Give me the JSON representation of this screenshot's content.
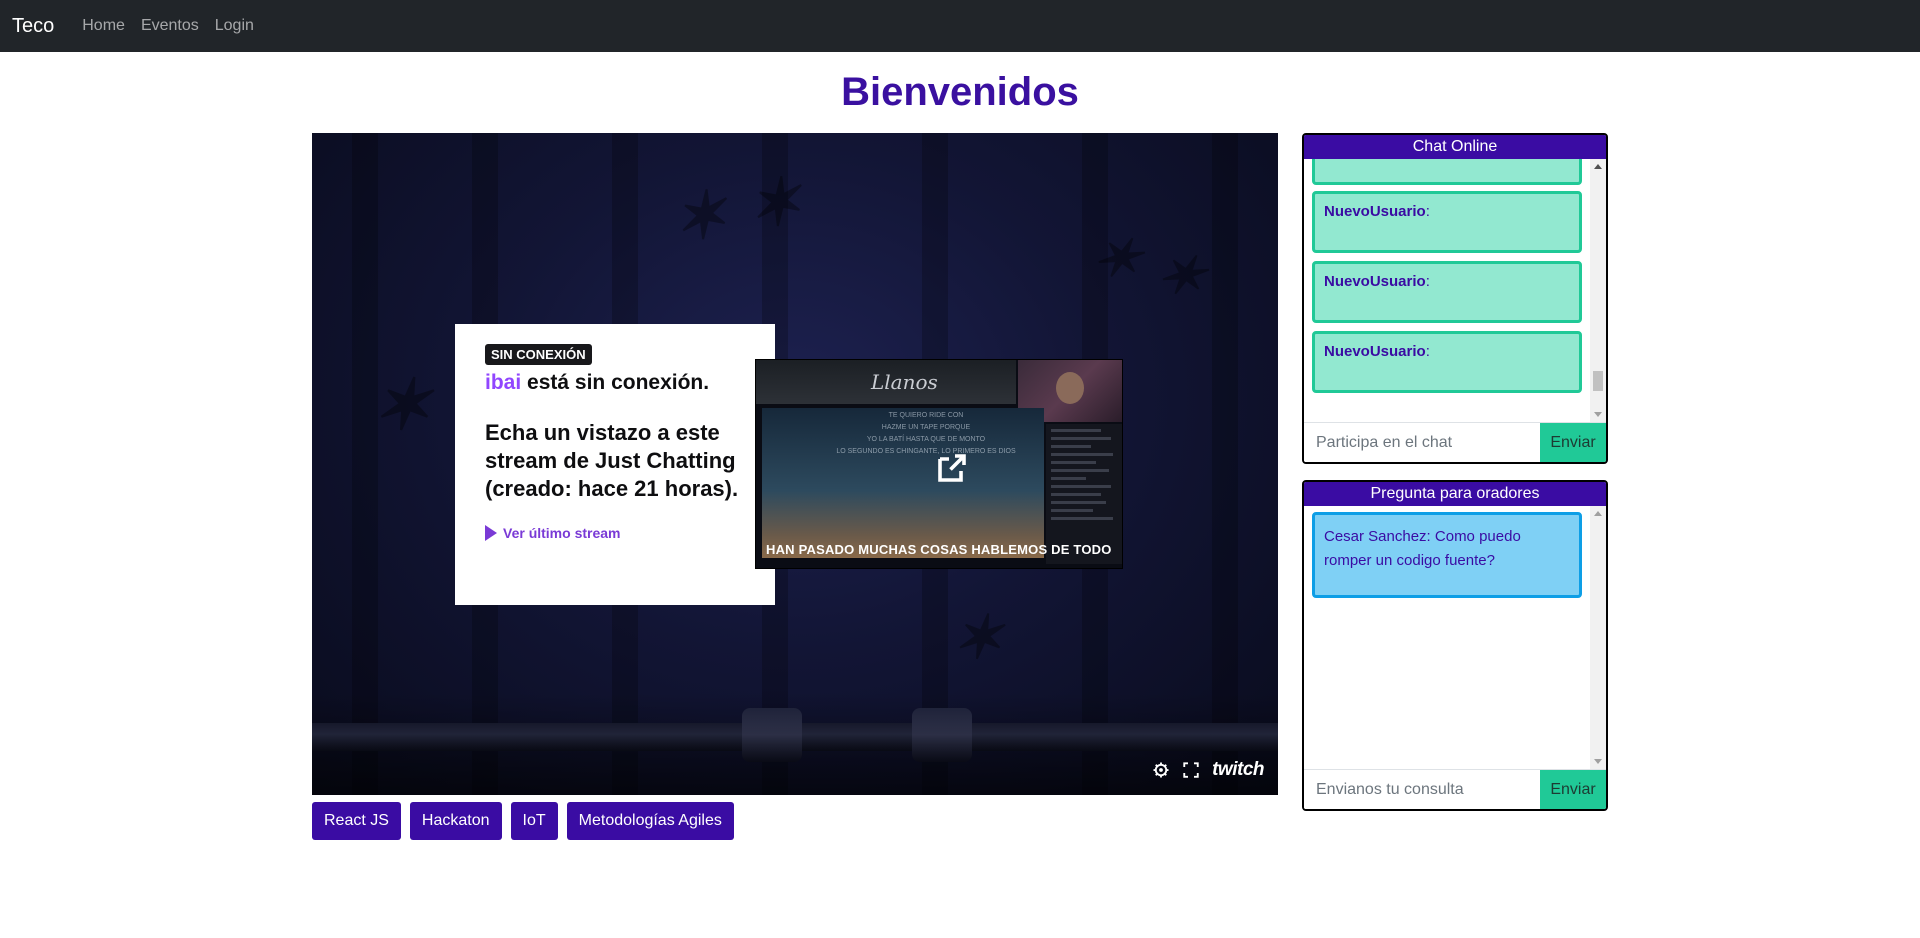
{
  "navbar": {
    "brand": "Teco",
    "links": [
      "Home",
      "Eventos",
      "Login"
    ],
    "background": "#212529"
  },
  "page": {
    "title": "Bienvenidos",
    "title_color": "#3a0ca3"
  },
  "video": {
    "offline_badge": "SIN CONEXIÓN",
    "channel": "ibai",
    "offline_title_rest": " está sin conexión.",
    "offline_message": "Echa un vistazo a este stream de Just Chatting (creado: hace 21 horas).",
    "last_stream_link": "Ver último stream",
    "thumbnail_caption": "HAN PASADO MUCHAS COSAS HABLEMOS DE TODO",
    "thumbnail_logo": "Llanos",
    "thumbnail_lyrics": [
      "TE QUIERO RIDE CON",
      "HAZME UN TAPE PORQUE",
      "YO LA BATÍ HASTA QUE DE MONTO",
      "LO SEGUNDO ES CHINGANTE, LO PRIMERO ES DIOS"
    ],
    "controls": {
      "settings_icon": "gear-icon",
      "fullscreen_icon": "fullscreen-icon",
      "logo": "twitch"
    },
    "twitch_purple": "#9146ff"
  },
  "tags": [
    "React JS",
    "Hackaton",
    "IoT",
    "Metodologías Agiles"
  ],
  "chat": {
    "header": "Chat Online",
    "messages": [
      {
        "user": "NuevoUsuario",
        "text": ""
      },
      {
        "user": "NuevoUsuario",
        "text": ""
      },
      {
        "user": "NuevoUsuario",
        "text": ""
      }
    ],
    "input_placeholder": "Participa en el chat",
    "send_label": "Enviar",
    "accent": "#20c997"
  },
  "questions": {
    "header": "Pregunta para oradores",
    "items": [
      {
        "text": "Cesar Sanchez: Como puedo romper un codigo fuente?"
      }
    ],
    "input_placeholder": "Envianos tu consulta",
    "send_label": "Enviar"
  }
}
